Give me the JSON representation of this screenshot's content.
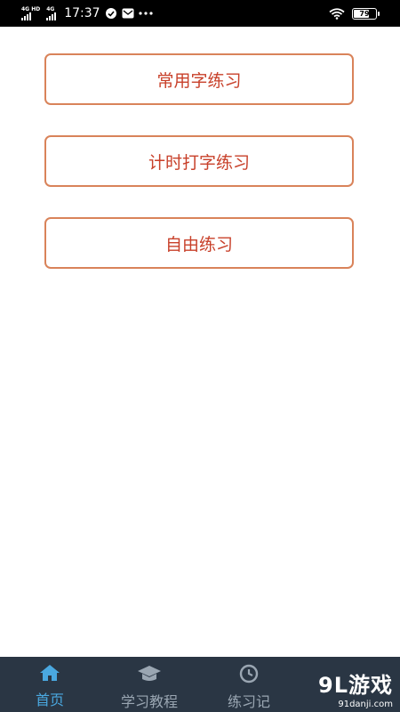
{
  "status_bar": {
    "network_1": "4G HD",
    "network_2": "4G",
    "time": "17:37",
    "battery_level": 79,
    "battery_text": "79"
  },
  "practice_options": [
    {
      "label": "常用字练习"
    },
    {
      "label": "计时打字练习"
    },
    {
      "label": "自由练习"
    }
  ],
  "colors": {
    "button_border": "#d9835a",
    "button_text": "#c8402a",
    "nav_background": "#2a3644",
    "nav_active": "#4aa8e0",
    "nav_inactive": "#9aa6b2"
  },
  "bottom_nav": {
    "items": [
      {
        "label": "首页",
        "icon": "home-icon",
        "active": true
      },
      {
        "label": "学习教程",
        "icon": "graduation-cap-icon",
        "active": false
      },
      {
        "label": "练习记",
        "icon": "record-icon",
        "active": false
      }
    ]
  },
  "watermark": {
    "main": "9L游戏",
    "sub": "91danji.com"
  }
}
